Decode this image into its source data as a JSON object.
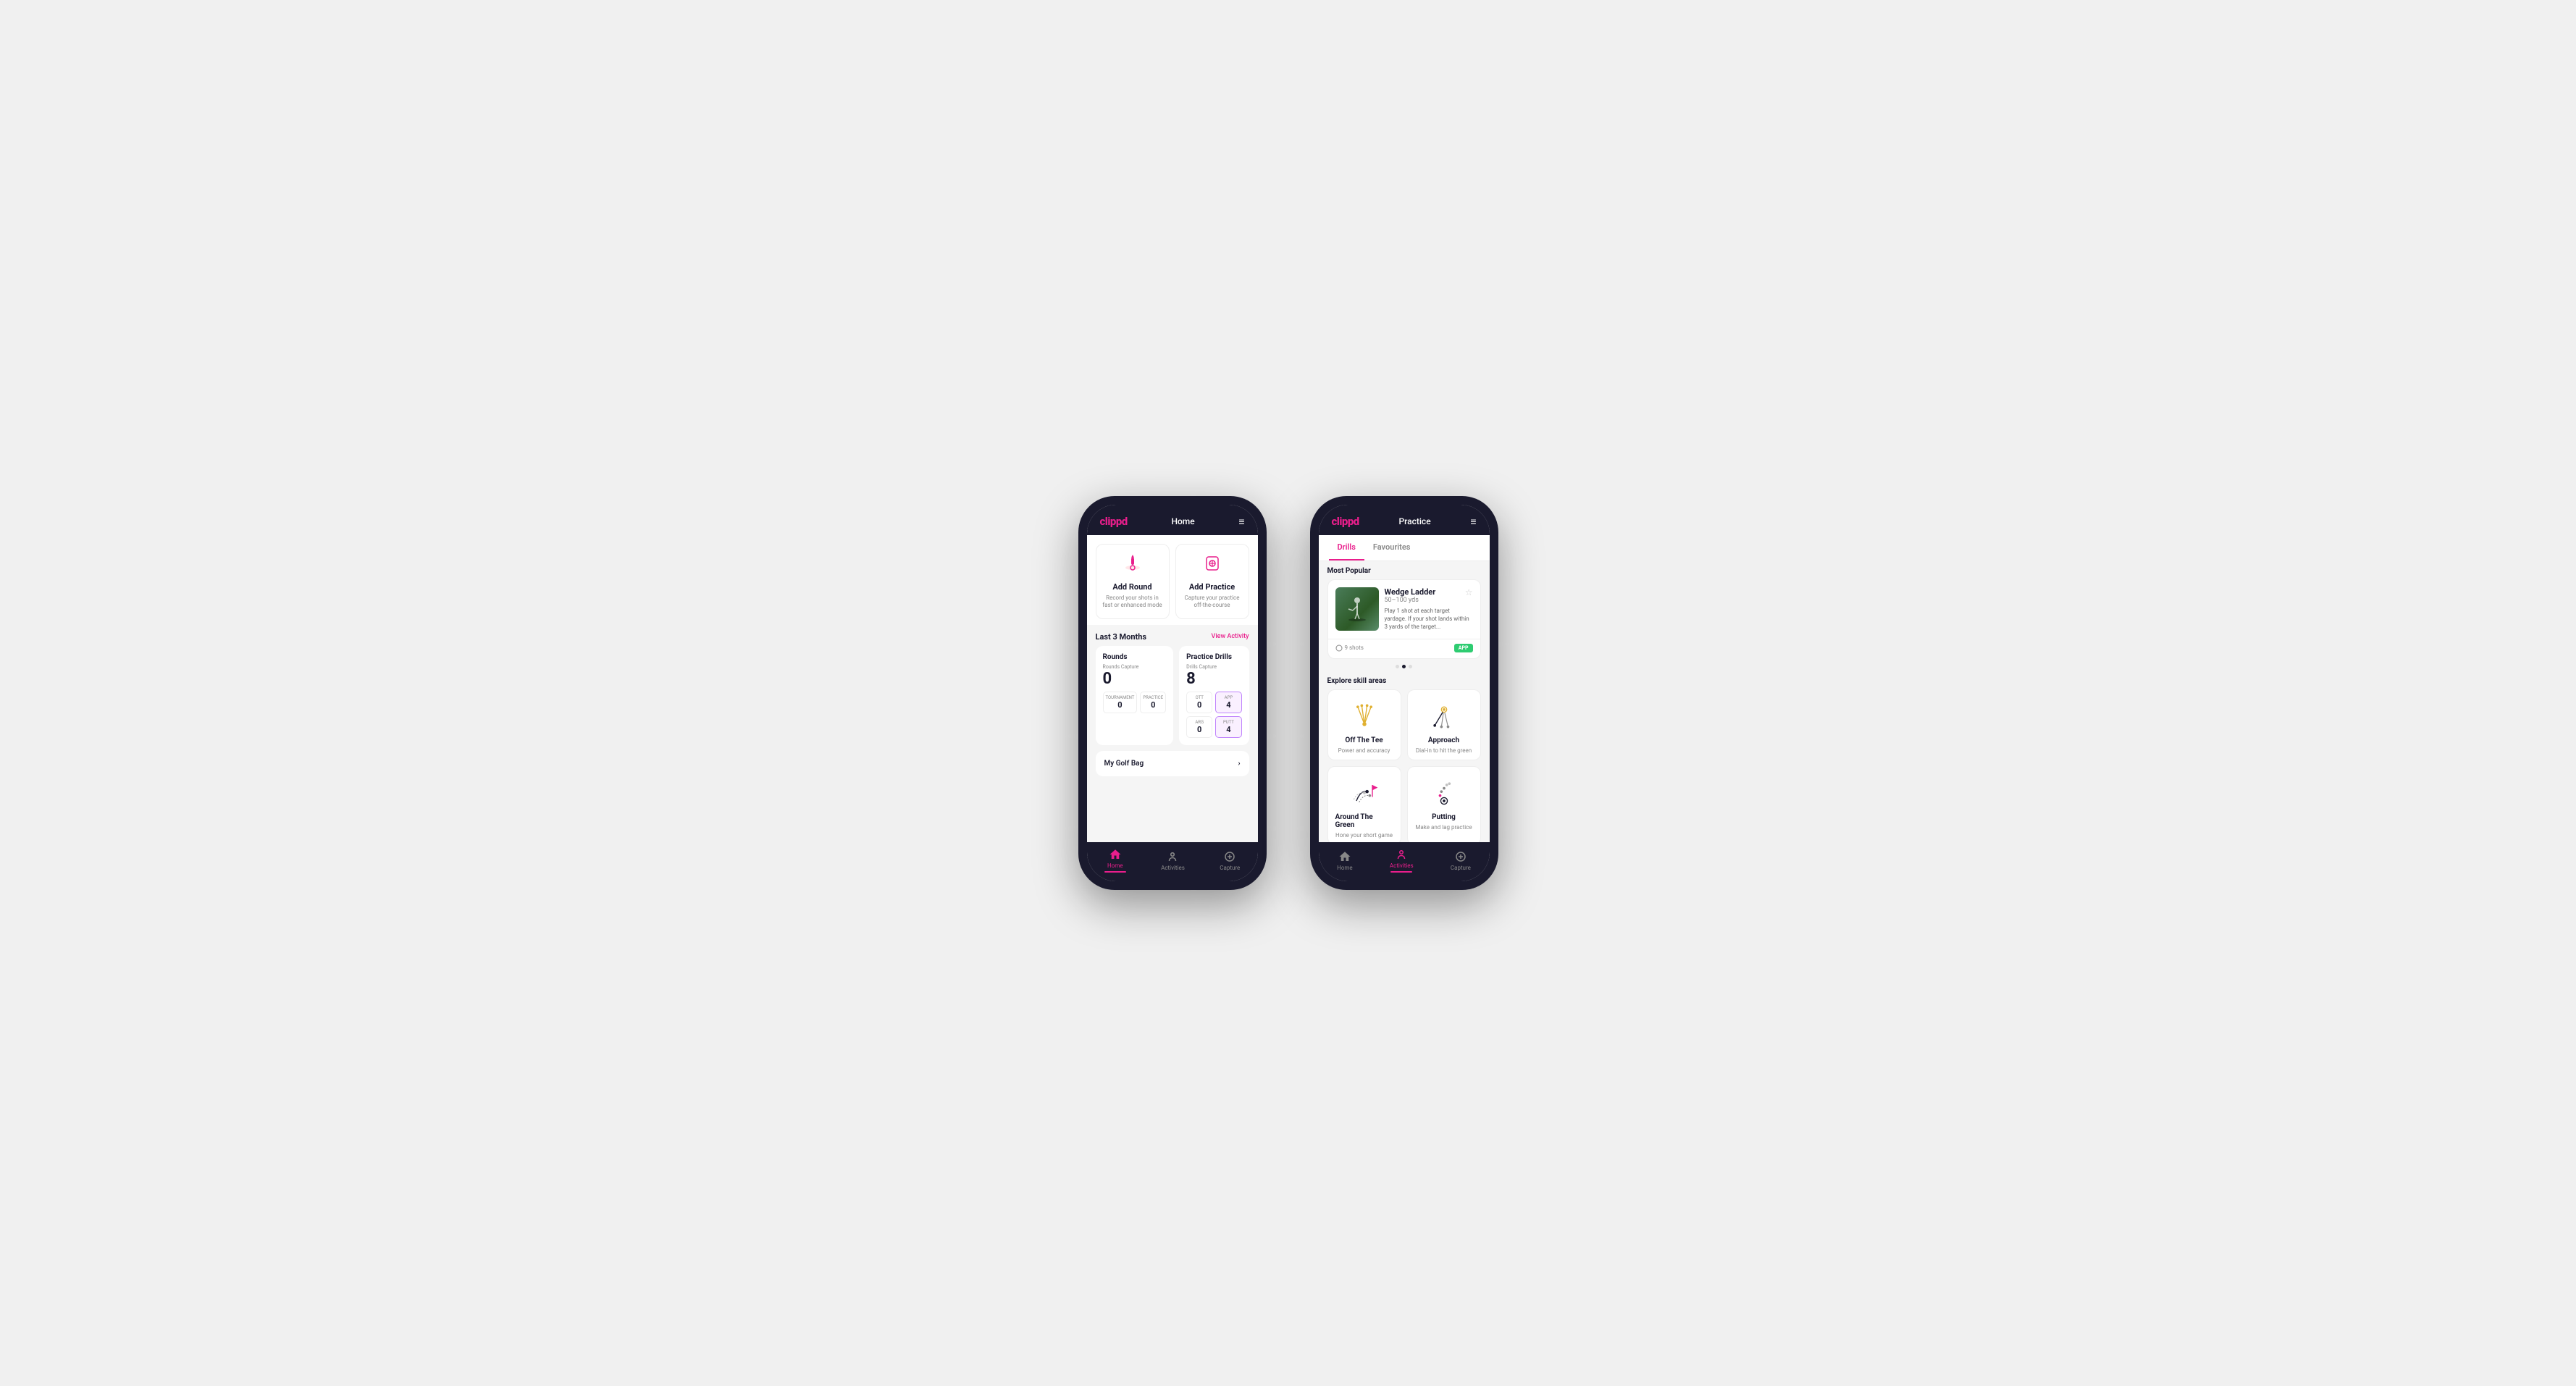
{
  "phone1": {
    "header": {
      "logo": "clippd",
      "title": "Home",
      "menu_icon": "≡"
    },
    "action_cards": [
      {
        "id": "add-round",
        "title": "Add Round",
        "subtitle": "Record your shots in fast or enhanced mode",
        "icon": "🏌️"
      },
      {
        "id": "add-practice",
        "title": "Add Practice",
        "subtitle": "Capture your practice off-the-course",
        "icon": "🎯"
      }
    ],
    "last3months": {
      "label": "Last 3 Months",
      "link": "View Activity"
    },
    "rounds": {
      "title": "Rounds",
      "capture_label": "Rounds Capture",
      "capture_value": "0",
      "tournament_label": "Tournament",
      "tournament_value": "0",
      "practice_label": "Practice",
      "practice_value": "0"
    },
    "drills": {
      "title": "Practice Drills",
      "capture_label": "Drills Capture",
      "capture_value": "8",
      "ott_label": "OTT",
      "ott_value": "0",
      "app_label": "APP",
      "app_value": "4",
      "arg_label": "ARG",
      "arg_value": "0",
      "putt_label": "PUTT",
      "putt_value": "4"
    },
    "golf_bag": {
      "label": "My Golf Bag"
    },
    "nav": [
      {
        "id": "home",
        "label": "Home",
        "active": true
      },
      {
        "id": "activities",
        "label": "Activities",
        "active": false
      },
      {
        "id": "capture",
        "label": "Capture",
        "active": false
      }
    ]
  },
  "phone2": {
    "header": {
      "logo": "clippd",
      "title": "Practice",
      "menu_icon": "≡"
    },
    "tabs": [
      {
        "id": "drills",
        "label": "Drills",
        "active": true
      },
      {
        "id": "favourites",
        "label": "Favourites",
        "active": false
      }
    ],
    "most_popular": {
      "label": "Most Popular",
      "featured": {
        "title": "Wedge Ladder",
        "subtitle": "50–100 yds",
        "description": "Play 1 shot at each target yardage. If your shot lands within 3 yards of the target...",
        "shots_label": "9 shots",
        "badge": "APP"
      },
      "dots": [
        {
          "active": false
        },
        {
          "active": true
        },
        {
          "active": false
        }
      ]
    },
    "explore": {
      "label": "Explore skill areas",
      "skills": [
        {
          "id": "off-the-tee",
          "name": "Off The Tee",
          "desc": "Power and accuracy"
        },
        {
          "id": "approach",
          "name": "Approach",
          "desc": "Dial-in to hit the green"
        },
        {
          "id": "around-the-green",
          "name": "Around The Green",
          "desc": "Hone your short game"
        },
        {
          "id": "putting",
          "name": "Putting",
          "desc": "Make and lag practice"
        }
      ]
    },
    "nav": [
      {
        "id": "home",
        "label": "Home",
        "active": false
      },
      {
        "id": "activities",
        "label": "Activities",
        "active": true
      },
      {
        "id": "capture",
        "label": "Capture",
        "active": false
      }
    ]
  }
}
